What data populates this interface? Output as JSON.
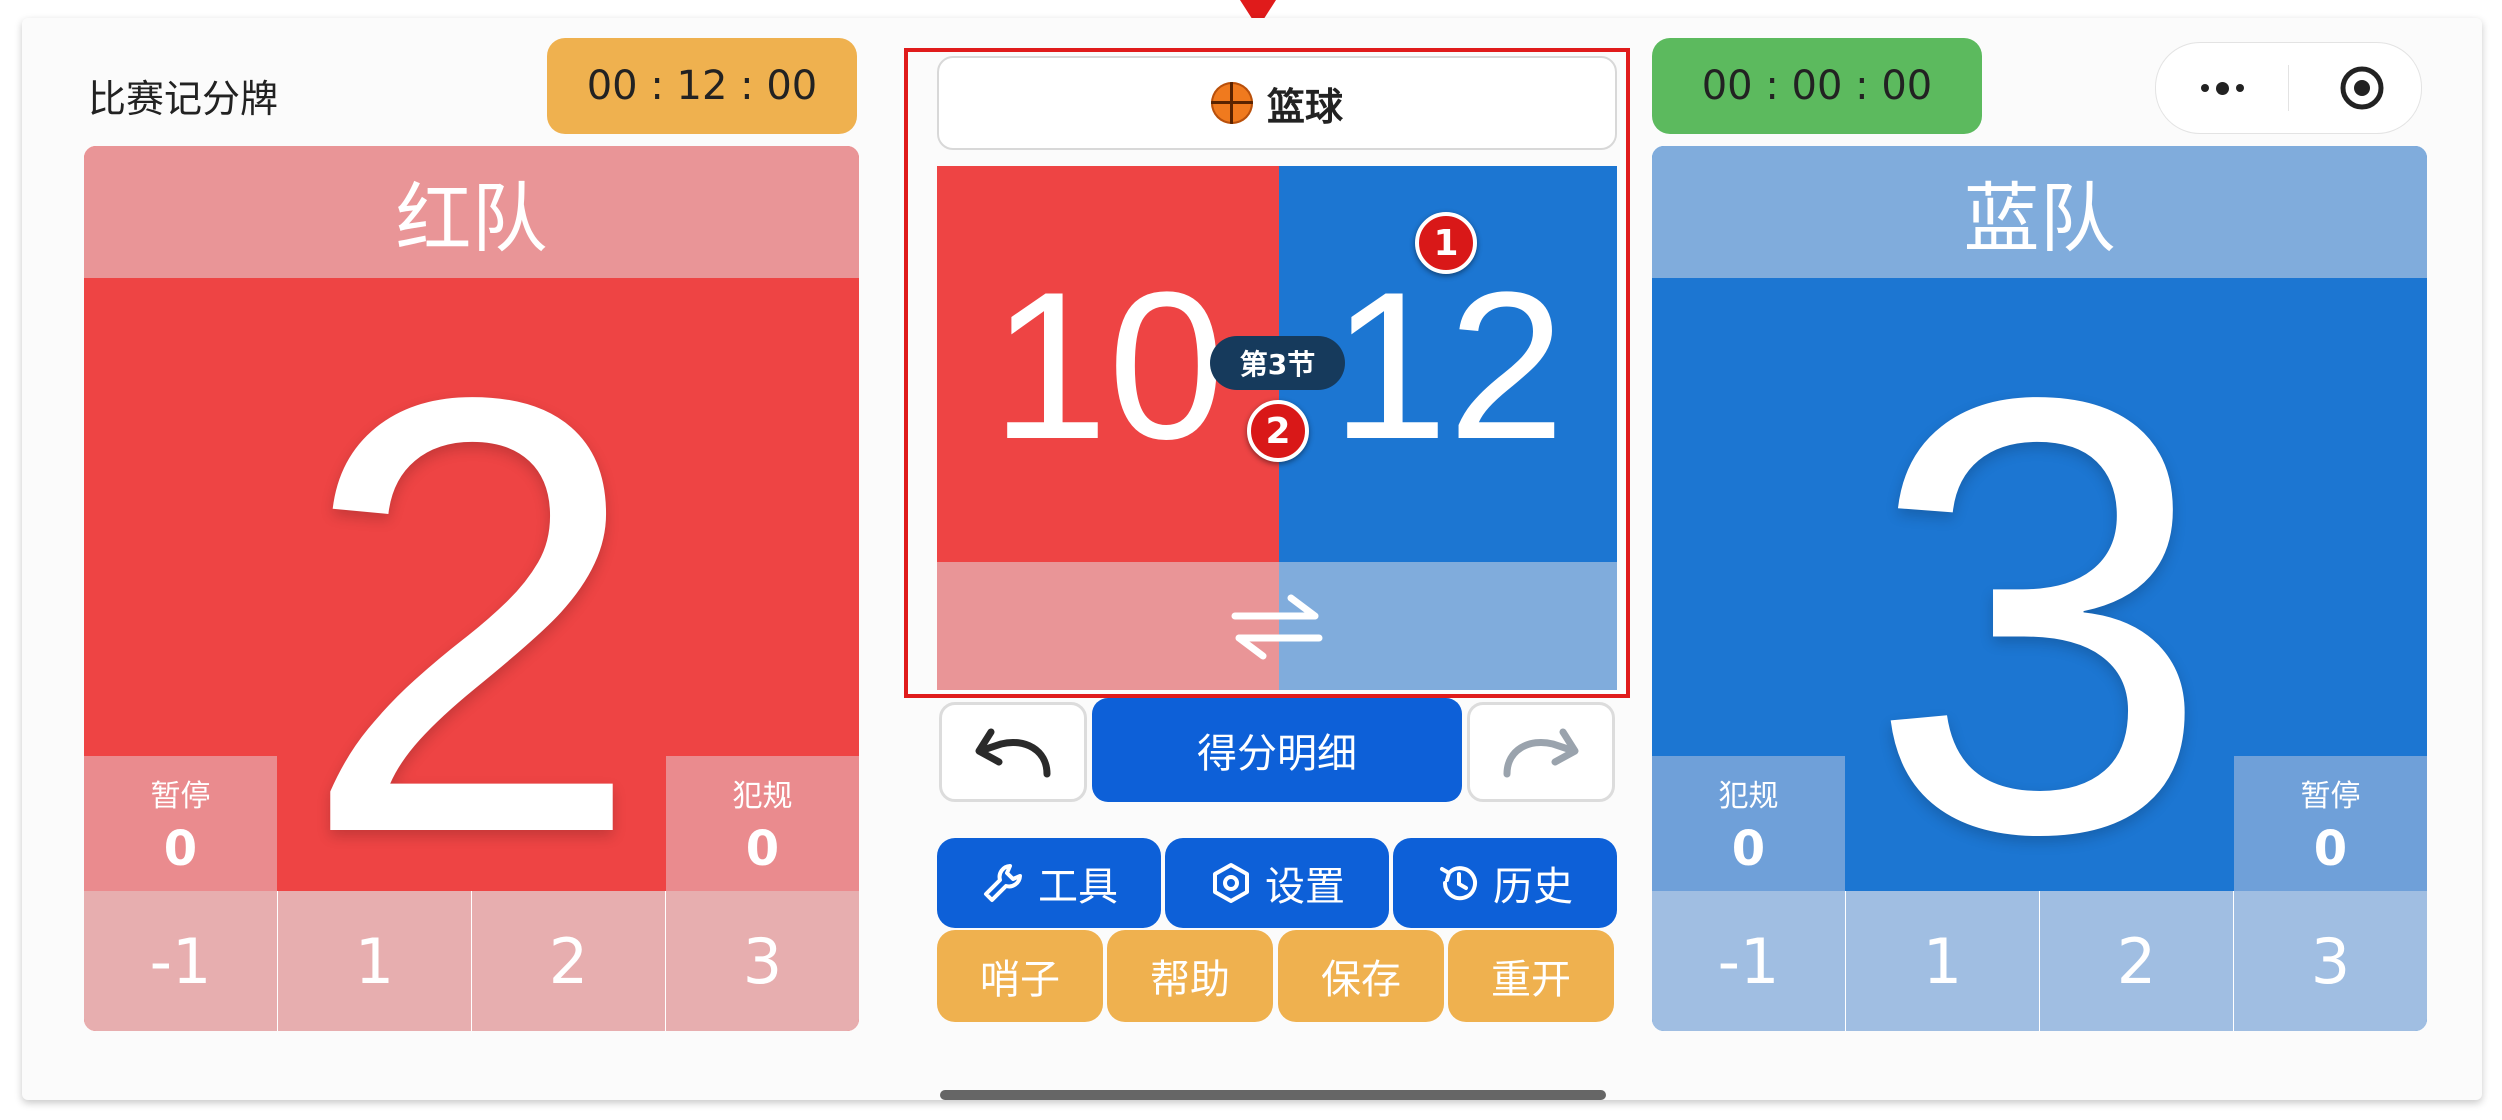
{
  "app": {
    "title": "比赛记分牌"
  },
  "timers": {
    "left": "00 : 12 : 00",
    "right": "00 : 00 : 00"
  },
  "capsule": {
    "more_icon": "more-dots-icon",
    "close_icon": "target-close-icon"
  },
  "sport": {
    "icon": "basketball-icon",
    "label": "篮球"
  },
  "red_team": {
    "name": "红队",
    "score": "2",
    "timeout_label": "暂停",
    "timeout_value": "0",
    "foul_label": "犯规",
    "foul_value": "0",
    "buttons": [
      "-1",
      "1",
      "2",
      "3"
    ],
    "color": "#ee4444"
  },
  "blue_team": {
    "name": "蓝队",
    "score": "3",
    "timeout_label": "暂停",
    "timeout_value": "0",
    "foul_label": "犯规",
    "foul_value": "0",
    "buttons": [
      "-1",
      "1",
      "2",
      "3"
    ],
    "color": "#1c76d2"
  },
  "match": {
    "red_score": "10",
    "blue_score": "12",
    "period": "第3节",
    "swap_icon": "swap-arrows-icon"
  },
  "annotations": {
    "badge1": "1",
    "badge2": "2",
    "accent": "#e01b1b"
  },
  "controls": {
    "undo_icon": "undo-icon",
    "redo_icon": "redo-icon",
    "detail_label": "得分明细"
  },
  "tools": [
    {
      "label": "工具",
      "icon": "wrench-icon"
    },
    {
      "label": "设置",
      "icon": "hexagon-settings-icon"
    },
    {
      "label": "历史",
      "icon": "history-clock-icon"
    }
  ],
  "actions": [
    "哨子",
    "帮助",
    "保存",
    "重开"
  ],
  "colors": {
    "primary_button": "#0d60d8",
    "secondary_button": "#efb14f",
    "timer_running": "#5cba5e"
  }
}
